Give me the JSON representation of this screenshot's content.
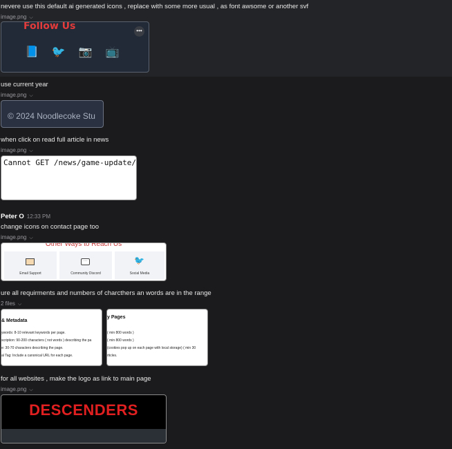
{
  "messages": [
    {
      "text": "nevere use this default ai generated icons , replace with some more usual , as font awsome or another svf",
      "attachment": "image.png"
    },
    {
      "text": "use current year",
      "attachment": "image.png"
    },
    {
      "text": "when click on read full article in news",
      "attachment": "image.png"
    },
    {
      "text": "change icons on contact page too",
      "attachment": "image.png"
    },
    {
      "text": "ure all requirments and numbers of charcthers an words are in the range",
      "attachment": "2 files"
    },
    {
      "text": "for all websites , make the logo as link to main page",
      "attachment": "image.png"
    }
  ],
  "author": {
    "name": "Peter O",
    "time": "12:33 PM"
  },
  "follow_card": {
    "title": "Follow Us",
    "icons": [
      "📘",
      "🐦",
      "📷",
      "📺"
    ],
    "icon_names": [
      "book-icon",
      "bird-icon",
      "camera-icon",
      "tv-icon"
    ]
  },
  "copyright_card": {
    "text": "© 2024 Noodlecoke Stu"
  },
  "error_card": {
    "text": "Cannot GET /news/game-update/"
  },
  "contact_card": {
    "title": "Other Ways to Reach Us",
    "items": [
      {
        "label": "Email Support",
        "icon": "email-icon"
      },
      {
        "label": "Community Discord",
        "icon": "chat-icon"
      },
      {
        "label": "Social Media",
        "icon": "bird-icon"
      }
    ]
  },
  "file1": {
    "title": "& Metadata",
    "lines": [
      "ywords: 8-10 relevant keywords per page.",
      "scription: 90-200 characters ( not words ) describing the pa",
      "e: 30-70 characters describing the page.",
      "al Tag: Include a canonical URL for each page."
    ]
  },
  "file2": {
    "title": "y Pages",
    "lines": [
      "( min 800 words )",
      "( min 800 words )",
      "(cookies pop up on each page with local storage) ( min 30",
      "rticles."
    ]
  },
  "logo_card": {
    "text": "DESCENDERS"
  }
}
